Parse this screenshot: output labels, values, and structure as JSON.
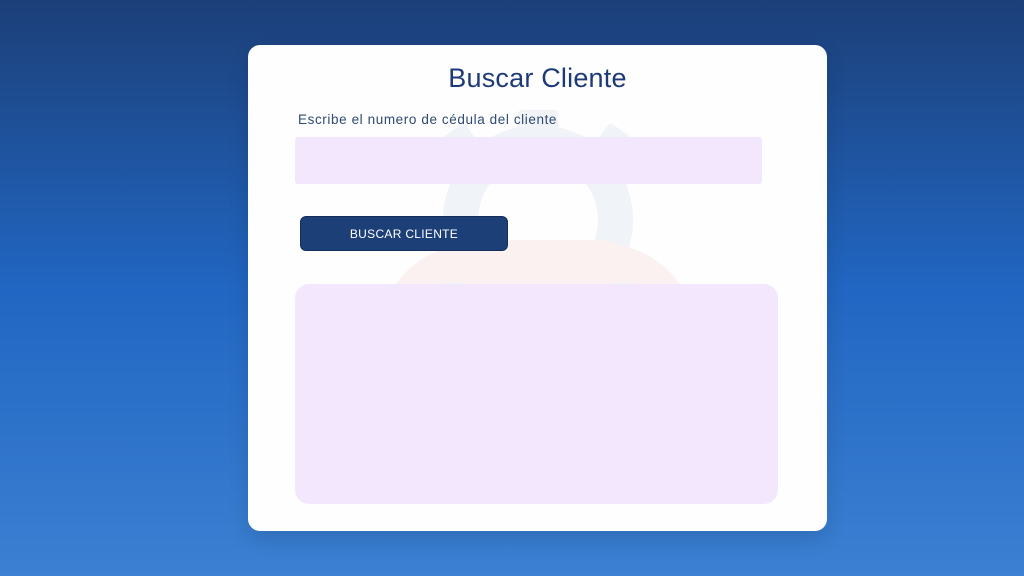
{
  "page": {
    "title": "Buscar Cliente"
  },
  "form": {
    "label": "Escribe el numero de cédula del cliente",
    "input_value": "",
    "input_placeholder": "",
    "button_label": "BUSCAR CLIENTE"
  },
  "results": {
    "content": ""
  },
  "colors": {
    "background_top": "#1c3f78",
    "background_bottom": "#3b80d2",
    "card": "#fefefe",
    "accent": "#1c3f78",
    "title_text": "#1d3a78",
    "field_fill": "#f3e7fd"
  },
  "icons": {
    "watermark": "car-gear-icon"
  }
}
